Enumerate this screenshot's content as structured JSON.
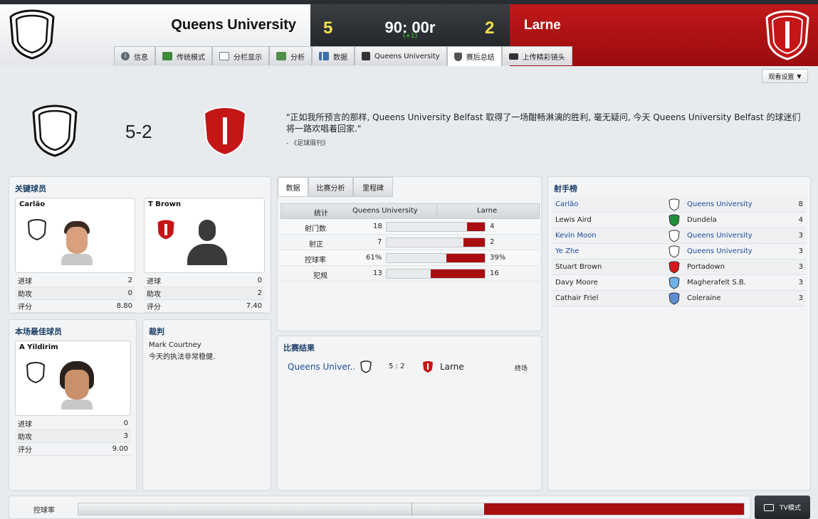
{
  "header": {
    "home_team": "Queens University",
    "home_goals": "5",
    "clock": "90: 00r",
    "added_time": "(+1)",
    "away_goals": "2",
    "away_team": "Larne",
    "colors": {
      "away_red": "#b01214",
      "score_yellow": "#f4e04a",
      "dark": "#2a2e33",
      "link_blue": "#1c4c9c"
    }
  },
  "tabs": [
    {
      "label": "信息",
      "icon": "info-icon"
    },
    {
      "label": "传统模式",
      "icon": "pitch-icon"
    },
    {
      "label": "分栏显示",
      "icon": "split-view-icon"
    },
    {
      "label": "分析",
      "icon": "analysis-icon"
    },
    {
      "label": "数据",
      "icon": "bar-chart-icon"
    },
    {
      "label": "Queens University",
      "icon": "dice-icon"
    },
    {
      "label": "赛后总结",
      "icon": "shield-icon"
    },
    {
      "label": "上传精彩镜头",
      "icon": "camera-icon"
    }
  ],
  "active_tab": "赛后总结",
  "watch_settings": "观看设置",
  "summary": {
    "score": "5-2",
    "quote": "\"正如我所预言的那样, Queens University Belfast 取得了一场酣畅淋漓的胜利, 毫无疑问, 今天 Queens University Belfast 的球迷们将一路欢唱着回家.\"",
    "quote_source": "- 《足球周刊》"
  },
  "key_players": {
    "title": "关键球员",
    "players": [
      {
        "name": "Carlão",
        "stats": [
          {
            "label": "进球",
            "value": "2"
          },
          {
            "label": "助攻",
            "value": "0"
          },
          {
            "label": "评分",
            "value": "8.80"
          }
        ]
      },
      {
        "name": "T Brown",
        "stats": [
          {
            "label": "进球",
            "value": "0"
          },
          {
            "label": "助攻",
            "value": "2"
          },
          {
            "label": "评分",
            "value": "7.40"
          }
        ]
      }
    ]
  },
  "motm": {
    "title": "本场最佳球员",
    "name": "A Yildirim",
    "stats": [
      {
        "label": "进球",
        "value": "0"
      },
      {
        "label": "助攻",
        "value": "3"
      },
      {
        "label": "评分",
        "value": "9.00"
      }
    ]
  },
  "referee": {
    "title": "裁判",
    "name": "Mark Courtney",
    "comment": "今天的执法非常稳健."
  },
  "stats": {
    "tabs": [
      "数据",
      "比赛分析",
      "里程碑"
    ],
    "header": {
      "label": "统计",
      "home": "Queens University",
      "away": "Larne"
    },
    "rows": [
      {
        "label": "射门数",
        "home": "18",
        "away": "4",
        "away_share": 0.18
      },
      {
        "label": "射正",
        "home": "7",
        "away": "2",
        "away_share": 0.22
      },
      {
        "label": "控球率",
        "home": "61%",
        "away": "39%",
        "away_share": 0.39
      },
      {
        "label": "犯规",
        "home": "13",
        "away": "16",
        "away_share": 0.55
      }
    ]
  },
  "result": {
    "title": "比赛结果",
    "home": "Queens Univer..",
    "score": "5 : 2",
    "away": "Larne",
    "status": "终场"
  },
  "scorers": {
    "title": "射手榜",
    "rows": [
      {
        "player": "Carlão",
        "club": "Queens University",
        "goals": "8",
        "link": true,
        "crest": "#ffffff"
      },
      {
        "player": "Lewis Aird",
        "club": "Dundela",
        "goals": "4",
        "link": false,
        "crest": "#1f8f3a"
      },
      {
        "player": "Kevin Moon",
        "club": "Queens University",
        "goals": "3",
        "link": true,
        "crest": "#ffffff"
      },
      {
        "player": "Ye Zhe",
        "club": "Queens University",
        "goals": "3",
        "link": true,
        "crest": "#ffffff"
      },
      {
        "player": "Stuart Brown",
        "club": "Portadown",
        "goals": "3",
        "link": false,
        "crest": "#d61a1a"
      },
      {
        "player": "Davy Moore",
        "club": "Magherafelt S.B.",
        "goals": "3",
        "link": false,
        "crest": "#6fb1e6"
      },
      {
        "player": "Cathair Friel",
        "club": "Coleraine",
        "goals": "3",
        "link": false,
        "crest": "#5b8fd1"
      }
    ]
  },
  "possession_bar": {
    "label": "控球率",
    "away_share": 0.39
  },
  "tv_mode": "TV模式"
}
